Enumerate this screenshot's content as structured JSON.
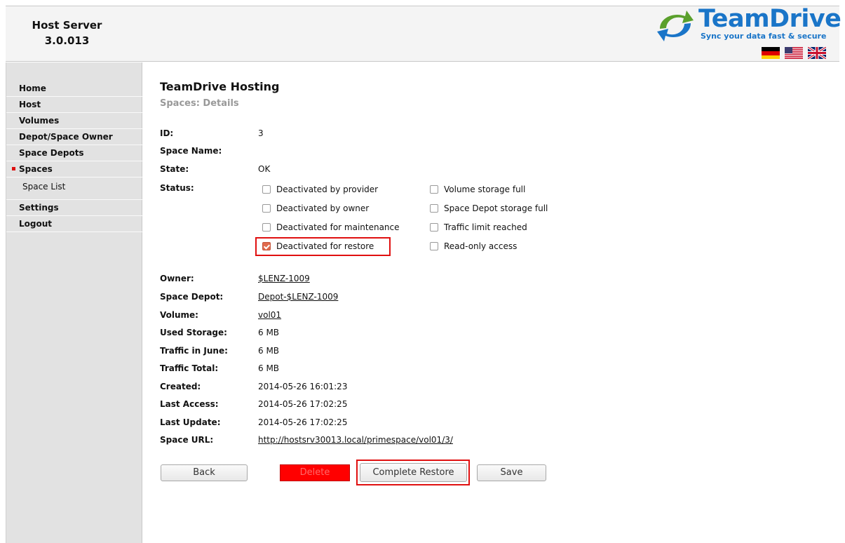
{
  "header": {
    "product_line1": "Host Server",
    "product_line2": "3.0.013",
    "logo_text": "TeamDrive",
    "logo_tagline": "Sync your data fast & secure",
    "flags": [
      "german-flag-icon",
      "us-flag-icon",
      "uk-flag-icon"
    ]
  },
  "sidebar": {
    "items": [
      {
        "label": "Home"
      },
      {
        "label": "Host"
      },
      {
        "label": "Volumes"
      },
      {
        "label": "Depot/Space Owner"
      },
      {
        "label": "Space Depots"
      },
      {
        "label": "Spaces"
      },
      {
        "label": "Space List"
      },
      {
        "label": "Settings"
      },
      {
        "label": "Logout"
      }
    ],
    "active_bullet_color": "#dd1111"
  },
  "main": {
    "title": "TeamDrive Hosting",
    "subtitle": "Spaces: Details",
    "id_label": "ID:",
    "id_value": "3",
    "space_name_label": "Space Name:",
    "state_label": "State:",
    "state_value": "OK",
    "status_label": "Status:",
    "status_options": [
      {
        "label": "Deactivated by provider",
        "checked": false
      },
      {
        "label": "Deactivated by owner",
        "checked": false
      },
      {
        "label": "Deactivated for maintenance",
        "checked": false
      },
      {
        "label": "Deactivated for restore",
        "checked": true
      },
      {
        "label": "Volume storage full",
        "checked": false
      },
      {
        "label": "Space Depot storage full",
        "checked": false
      },
      {
        "label": "Traffic limit reached",
        "checked": false
      },
      {
        "label": "Read-only access",
        "checked": false
      }
    ],
    "owner_label": "Owner:",
    "owner_value": "$LENZ-1009",
    "depot_label": "Space Depot:",
    "depot_value": "Depot-$LENZ-1009",
    "volume_label": "Volume:",
    "volume_value": "vol01",
    "used_label": "Used Storage:",
    "used_value": "6 MB",
    "traffic_month_label": "Traffic in June:",
    "traffic_month_value": "6 MB",
    "traffic_total_label": "Traffic Total:",
    "traffic_total_value": "6 MB",
    "created_label": "Created:",
    "created_value": "2014-05-26 16:01:23",
    "last_access_label": "Last Access:",
    "last_access_value": "2014-05-26 17:02:25",
    "last_update_label": "Last Update:",
    "last_update_value": "2014-05-26 17:02:25",
    "url_label": "Space URL:",
    "url_value": "http://hostsrv30013.local/primespace/vol01/3/"
  },
  "buttons": {
    "back": "Back",
    "delete": "Delete",
    "complete_restore": "Complete Restore",
    "save": "Save"
  },
  "colors": {
    "highlight_border": "#e01010",
    "delete_button": "#ff0000",
    "checked_checkbox": "#e06a4c",
    "logo_blue": "#1a75c8"
  }
}
